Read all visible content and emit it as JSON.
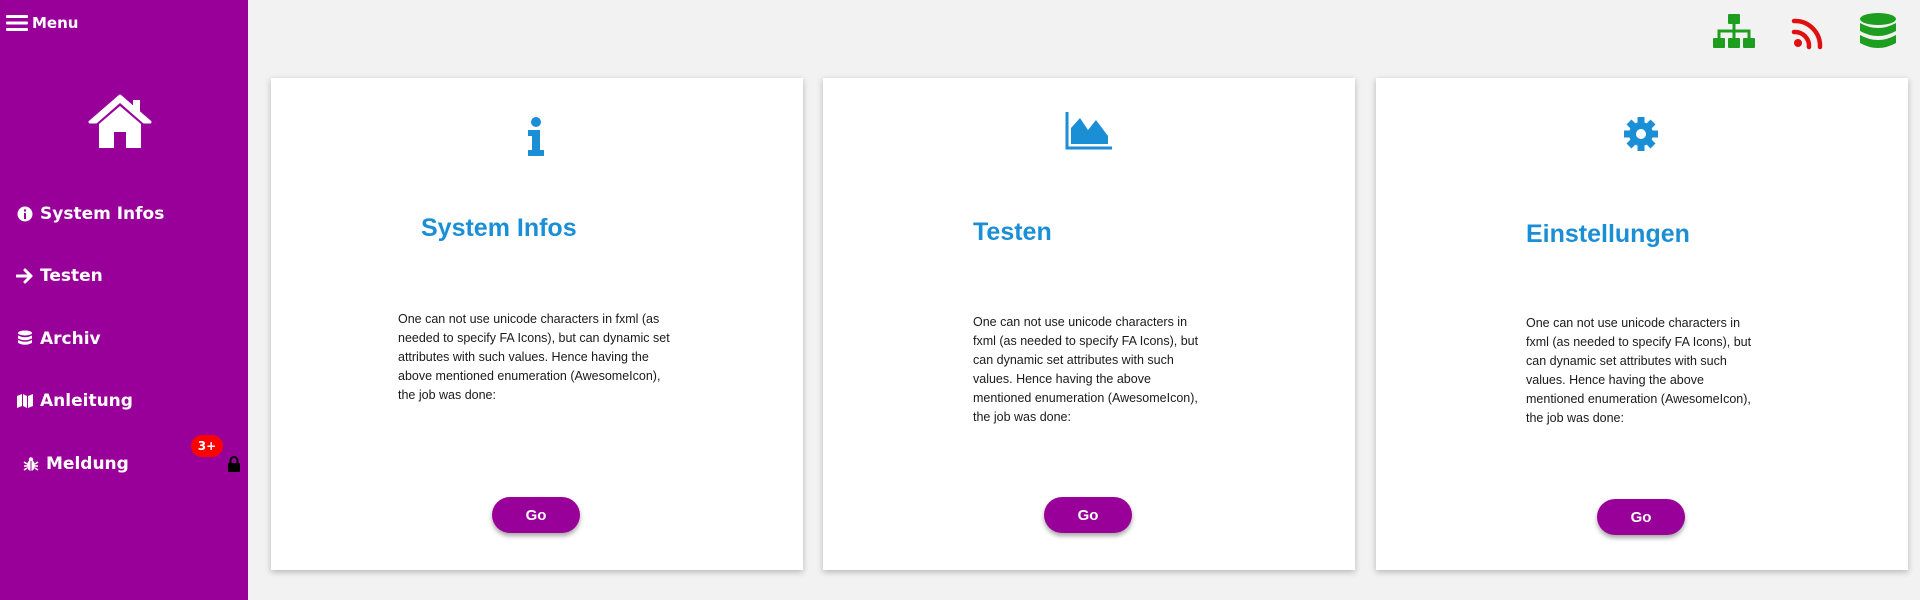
{
  "sidebar": {
    "menu_label": "Menu",
    "items": [
      {
        "label": "System Infos",
        "icon": "info-circle-icon"
      },
      {
        "label": "Testen",
        "icon": "arrow-right-icon"
      },
      {
        "label": "Archiv",
        "icon": "database-icon"
      },
      {
        "label": "Anleitung",
        "icon": "map-icon"
      },
      {
        "label": "Meldung",
        "icon": "bug-icon"
      }
    ],
    "notification_badge": "3+"
  },
  "status_icons": [
    {
      "name": "network-sitemap-icon",
      "color": "#1e9e1e"
    },
    {
      "name": "rss-feed-icon",
      "color": "#e01010"
    },
    {
      "name": "database-icon",
      "color": "#1e9e1e"
    }
  ],
  "cards": [
    {
      "title": "System Infos",
      "icon": "info-icon",
      "text": "One can not use unicode characters in fxml (as needed to specify FA Icons), but can dynamic set attributes with such values. Hence having the above mentioned enumeration (AwesomeIcon), the job was done:",
      "button": "Go"
    },
    {
      "title": "Testen",
      "icon": "area-chart-icon",
      "text": "One can not use unicode characters in fxml (as needed to specify FA Icons), but can dynamic set attributes with such values. Hence having the above mentioned enumeration (AwesomeIcon), the job was done:",
      "button": "Go"
    },
    {
      "title": "Einstellungen",
      "icon": "gear-icon",
      "text": "One can not use unicode characters in fxml (as needed to specify FA Icons), but can dynamic set attributes with such values. Hence having the above mentioned enumeration (AwesomeIcon), the job was done:",
      "button": "Go"
    }
  ],
  "colors": {
    "sidebar_bg": "#990099",
    "accent_blue": "#1a8fd6",
    "button_bg": "#990099",
    "badge_red": "#ff0000"
  }
}
